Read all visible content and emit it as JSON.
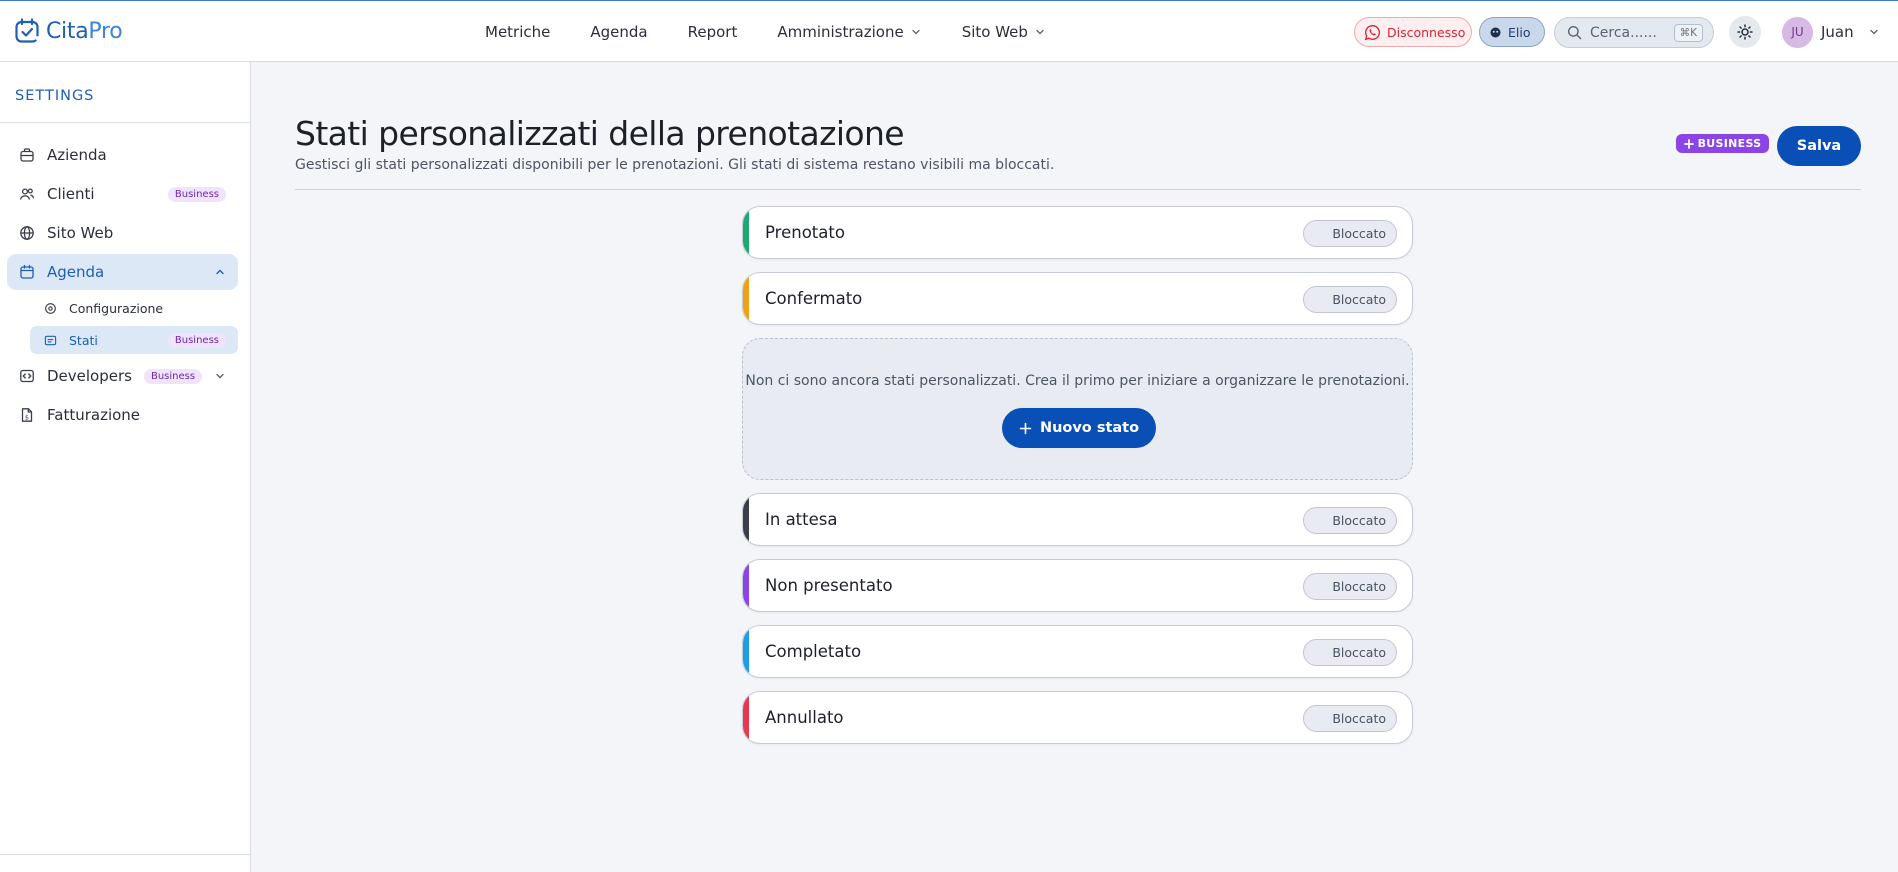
{
  "app": {
    "name_part1": "Cita",
    "name_part2": "Pro"
  },
  "topnav": {
    "items": [
      {
        "label": "Metriche",
        "has_menu": false
      },
      {
        "label": "Agenda",
        "has_menu": false
      },
      {
        "label": "Report",
        "has_menu": false
      },
      {
        "label": "Amministrazione",
        "has_menu": true
      },
      {
        "label": "Sito Web",
        "has_menu": true
      }
    ],
    "disconnected_label": "Disconnesso",
    "assistant_label": "Elio",
    "search_placeholder": "Cerca......",
    "search_shortcut": "⌘K",
    "user_initials": "JU",
    "user_name": "Juan"
  },
  "sidebar": {
    "title": "SETTINGS",
    "items": [
      {
        "label": "Azienda",
        "icon": "building-icon",
        "active": false
      },
      {
        "label": "Clienti",
        "icon": "users-icon",
        "badge": "Business",
        "active": false
      },
      {
        "label": "Sito Web",
        "icon": "globe-icon",
        "active": false
      },
      {
        "label": "Agenda",
        "icon": "calendar-icon",
        "active": true,
        "expanded": true,
        "children": [
          {
            "label": "Configurazione",
            "icon": "settings-icon",
            "active": false
          },
          {
            "label": "Stati",
            "icon": "status-icon",
            "badge": "Business",
            "active": true
          }
        ]
      },
      {
        "label": "Developers",
        "icon": "code-icon",
        "badge": "Business",
        "active": false
      },
      {
        "label": "Fatturazione",
        "icon": "invoice-icon",
        "active": false
      }
    ]
  },
  "page": {
    "title": "Stati personalizzati della prenotazione",
    "subtitle": "Gestisci gli stati personalizzati disponibili per le prenotazioni. Gli stati di sistema restano visibili ma bloccati.",
    "plan_tag": "BUSINESS",
    "save_label": "Salva"
  },
  "statuses_before": [
    {
      "label": "Prenotato",
      "color": "#1fa971",
      "lock_label": "Bloccato"
    },
    {
      "label": "Confermato",
      "color": "#efa215",
      "lock_label": "Bloccato"
    }
  ],
  "empty_state": {
    "message": "Non ci sono ancora stati personalizzati. Crea il primo per iniziare a organizzare le prenotazioni.",
    "new_button_label": "Nuovo stato"
  },
  "statuses_after": [
    {
      "label": "In attesa",
      "color": "#3a3f4b",
      "lock_label": "Bloccato"
    },
    {
      "label": "Non presentato",
      "color": "#8b45e6",
      "lock_label": "Bloccato"
    },
    {
      "label": "Completato",
      "color": "#1b9fe0",
      "lock_label": "Bloccato"
    },
    {
      "label": "Annullato",
      "color": "#e8384f",
      "lock_label": "Bloccato"
    }
  ],
  "colors": {
    "brand": "#1f5fb4",
    "primary_button": "#0a4fb6",
    "business_purple": "#8b45e6"
  }
}
